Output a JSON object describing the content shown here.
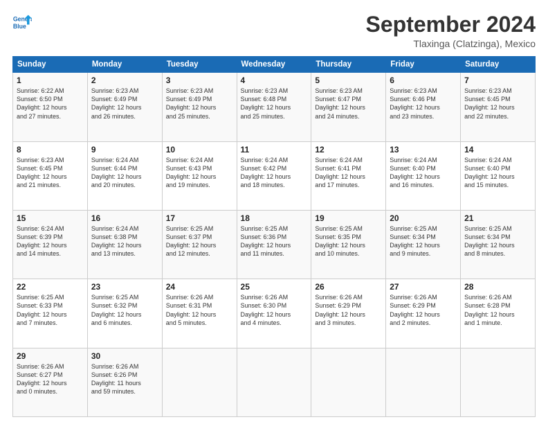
{
  "header": {
    "logo_line1": "General",
    "logo_line2": "Blue",
    "month_year": "September 2024",
    "location": "Tlaxinga (Clatzinga), Mexico"
  },
  "weekdays": [
    "Sunday",
    "Monday",
    "Tuesday",
    "Wednesday",
    "Thursday",
    "Friday",
    "Saturday"
  ],
  "weeks": [
    [
      {
        "day": "1",
        "info": "Sunrise: 6:22 AM\nSunset: 6:50 PM\nDaylight: 12 hours\nand 27 minutes."
      },
      {
        "day": "2",
        "info": "Sunrise: 6:23 AM\nSunset: 6:49 PM\nDaylight: 12 hours\nand 26 minutes."
      },
      {
        "day": "3",
        "info": "Sunrise: 6:23 AM\nSunset: 6:49 PM\nDaylight: 12 hours\nand 25 minutes."
      },
      {
        "day": "4",
        "info": "Sunrise: 6:23 AM\nSunset: 6:48 PM\nDaylight: 12 hours\nand 25 minutes."
      },
      {
        "day": "5",
        "info": "Sunrise: 6:23 AM\nSunset: 6:47 PM\nDaylight: 12 hours\nand 24 minutes."
      },
      {
        "day": "6",
        "info": "Sunrise: 6:23 AM\nSunset: 6:46 PM\nDaylight: 12 hours\nand 23 minutes."
      },
      {
        "day": "7",
        "info": "Sunrise: 6:23 AM\nSunset: 6:45 PM\nDaylight: 12 hours\nand 22 minutes."
      }
    ],
    [
      {
        "day": "8",
        "info": "Sunrise: 6:23 AM\nSunset: 6:45 PM\nDaylight: 12 hours\nand 21 minutes."
      },
      {
        "day": "9",
        "info": "Sunrise: 6:24 AM\nSunset: 6:44 PM\nDaylight: 12 hours\nand 20 minutes."
      },
      {
        "day": "10",
        "info": "Sunrise: 6:24 AM\nSunset: 6:43 PM\nDaylight: 12 hours\nand 19 minutes."
      },
      {
        "day": "11",
        "info": "Sunrise: 6:24 AM\nSunset: 6:42 PM\nDaylight: 12 hours\nand 18 minutes."
      },
      {
        "day": "12",
        "info": "Sunrise: 6:24 AM\nSunset: 6:41 PM\nDaylight: 12 hours\nand 17 minutes."
      },
      {
        "day": "13",
        "info": "Sunrise: 6:24 AM\nSunset: 6:40 PM\nDaylight: 12 hours\nand 16 minutes."
      },
      {
        "day": "14",
        "info": "Sunrise: 6:24 AM\nSunset: 6:40 PM\nDaylight: 12 hours\nand 15 minutes."
      }
    ],
    [
      {
        "day": "15",
        "info": "Sunrise: 6:24 AM\nSunset: 6:39 PM\nDaylight: 12 hours\nand 14 minutes."
      },
      {
        "day": "16",
        "info": "Sunrise: 6:24 AM\nSunset: 6:38 PM\nDaylight: 12 hours\nand 13 minutes."
      },
      {
        "day": "17",
        "info": "Sunrise: 6:25 AM\nSunset: 6:37 PM\nDaylight: 12 hours\nand 12 minutes."
      },
      {
        "day": "18",
        "info": "Sunrise: 6:25 AM\nSunset: 6:36 PM\nDaylight: 12 hours\nand 11 minutes."
      },
      {
        "day": "19",
        "info": "Sunrise: 6:25 AM\nSunset: 6:35 PM\nDaylight: 12 hours\nand 10 minutes."
      },
      {
        "day": "20",
        "info": "Sunrise: 6:25 AM\nSunset: 6:34 PM\nDaylight: 12 hours\nand 9 minutes."
      },
      {
        "day": "21",
        "info": "Sunrise: 6:25 AM\nSunset: 6:34 PM\nDaylight: 12 hours\nand 8 minutes."
      }
    ],
    [
      {
        "day": "22",
        "info": "Sunrise: 6:25 AM\nSunset: 6:33 PM\nDaylight: 12 hours\nand 7 minutes."
      },
      {
        "day": "23",
        "info": "Sunrise: 6:25 AM\nSunset: 6:32 PM\nDaylight: 12 hours\nand 6 minutes."
      },
      {
        "day": "24",
        "info": "Sunrise: 6:26 AM\nSunset: 6:31 PM\nDaylight: 12 hours\nand 5 minutes."
      },
      {
        "day": "25",
        "info": "Sunrise: 6:26 AM\nSunset: 6:30 PM\nDaylight: 12 hours\nand 4 minutes."
      },
      {
        "day": "26",
        "info": "Sunrise: 6:26 AM\nSunset: 6:29 PM\nDaylight: 12 hours\nand 3 minutes."
      },
      {
        "day": "27",
        "info": "Sunrise: 6:26 AM\nSunset: 6:29 PM\nDaylight: 12 hours\nand 2 minutes."
      },
      {
        "day": "28",
        "info": "Sunrise: 6:26 AM\nSunset: 6:28 PM\nDaylight: 12 hours\nand 1 minute."
      }
    ],
    [
      {
        "day": "29",
        "info": "Sunrise: 6:26 AM\nSunset: 6:27 PM\nDaylight: 12 hours\nand 0 minutes."
      },
      {
        "day": "30",
        "info": "Sunrise: 6:26 AM\nSunset: 6:26 PM\nDaylight: 11 hours\nand 59 minutes."
      },
      {
        "day": "",
        "info": ""
      },
      {
        "day": "",
        "info": ""
      },
      {
        "day": "",
        "info": ""
      },
      {
        "day": "",
        "info": ""
      },
      {
        "day": "",
        "info": ""
      }
    ]
  ]
}
